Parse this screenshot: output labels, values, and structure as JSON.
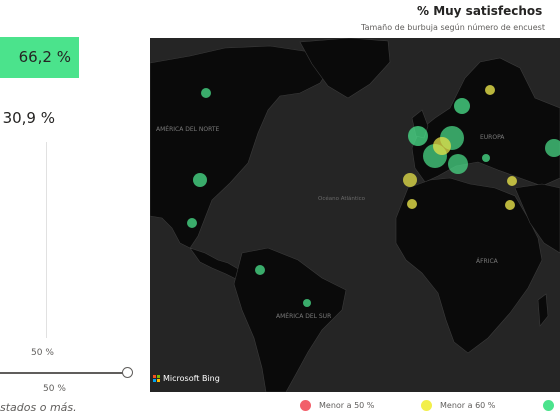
{
  "kpis": {
    "primary": "66,2 %",
    "secondary": "30,9 %"
  },
  "slider": {
    "label_top": "50 %",
    "label_bottom": "50 %"
  },
  "footnote": "stados o más.",
  "map": {
    "title": "% Muy satisfechos",
    "subtitle": "Tamaño de burbuja según número de encuest",
    "provider": "Microsoft Bing",
    "labels": {
      "north_america": "AMÉRICA DEL NORTE",
      "south_america": "AMÉRICA DEL SUR",
      "ocean": "Océano Atlántico",
      "europe": "EUROPA",
      "africa": "ÁFRICA"
    }
  },
  "legend": [
    {
      "label": "Menor a 50 %",
      "color": "#f25f6a"
    },
    {
      "label": "Menor a 60 %",
      "color": "#f2ef4b"
    },
    {
      "label": "",
      "color": "#4be38c"
    }
  ],
  "colors": {
    "good": "#4be38c",
    "medium": "#e6e14a",
    "bad": "#f25f6a",
    "map_bg": "#252525",
    "land": "#0a0a0a"
  },
  "bubbles": [
    {
      "name": "canada-west",
      "color": "green",
      "size": "small"
    },
    {
      "name": "usa-central",
      "color": "green",
      "size": "medium"
    },
    {
      "name": "mexico",
      "color": "green",
      "size": "small"
    },
    {
      "name": "colombia",
      "color": "green",
      "size": "small"
    },
    {
      "name": "brazil-central",
      "color": "green",
      "size": "small"
    },
    {
      "name": "uk",
      "color": "green",
      "size": "large"
    },
    {
      "name": "france",
      "color": "green",
      "size": "large"
    },
    {
      "name": "germany",
      "color": "green",
      "size": "large"
    },
    {
      "name": "scandinavia",
      "color": "green",
      "size": "medium"
    },
    {
      "name": "finland",
      "color": "yellow",
      "size": "small"
    },
    {
      "name": "italy",
      "color": "yellow",
      "size": "medium"
    },
    {
      "name": "spain",
      "color": "yellow",
      "size": "medium"
    },
    {
      "name": "morocco",
      "color": "yellow",
      "size": "small"
    },
    {
      "name": "turkey",
      "color": "yellow",
      "size": "small"
    },
    {
      "name": "egypt",
      "color": "yellow",
      "size": "small"
    },
    {
      "name": "balkans",
      "color": "green",
      "size": "small"
    },
    {
      "name": "east-europe",
      "color": "green",
      "size": "medium"
    }
  ]
}
